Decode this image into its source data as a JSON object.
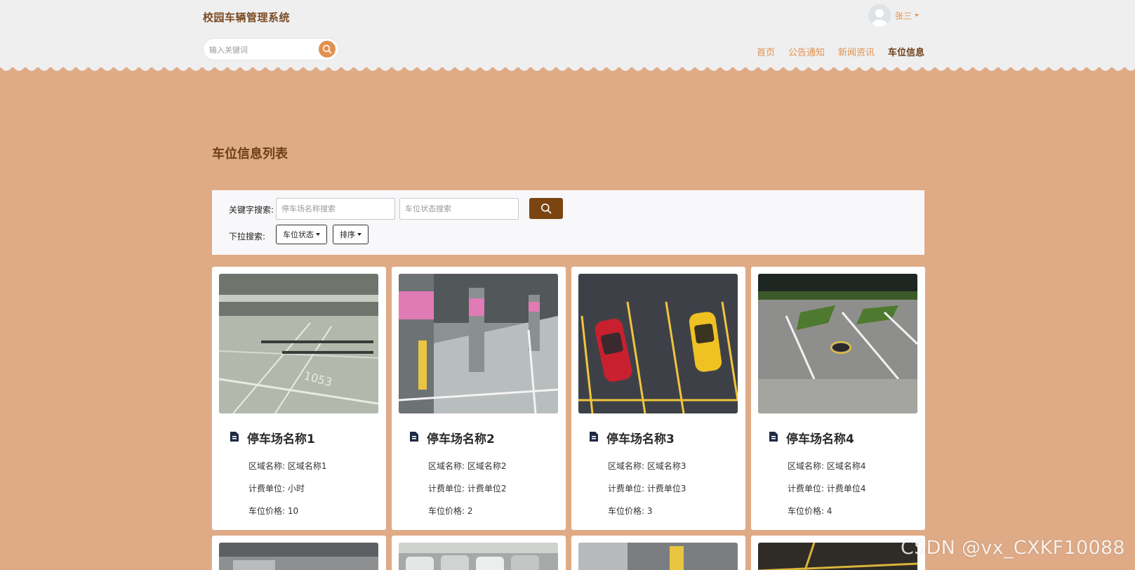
{
  "header": {
    "site_title": "校园车辆管理系统",
    "search_placeholder": "输入关键词",
    "user_name": "张三",
    "nav": [
      {
        "label": "首页",
        "active": false
      },
      {
        "label": "公告通知",
        "active": false
      },
      {
        "label": "新闻资讯",
        "active": false
      },
      {
        "label": "车位信息",
        "active": true
      }
    ]
  },
  "main": {
    "title": "车位信息列表",
    "filter": {
      "keyword_label": "关键字搜索:",
      "parking_placeholder": "停车场名称搜索",
      "status_placeholder": "车位状态搜索",
      "dropdown_label": "下拉搜索:",
      "status_dropdown": "车位状态",
      "sort_dropdown": "排序"
    },
    "cards": [
      {
        "title": "停车场名称1",
        "region": "区域名称: 区域名称1",
        "unit": "计费单位: 小时",
        "price": "车位价格: 10"
      },
      {
        "title": "停车场名称2",
        "region": "区域名称: 区域名称2",
        "unit": "计费单位: 计费单位2",
        "price": "车位价格: 2"
      },
      {
        "title": "停车场名称3",
        "region": "区域名称: 区域名称3",
        "unit": "计费单位: 计费单位3",
        "price": "车位价格: 3"
      },
      {
        "title": "停车场名称4",
        "region": "区域名称: 区域名称4",
        "unit": "计费单位: 计费单位4",
        "price": "车位价格: 4"
      }
    ]
  },
  "watermark": "CSDN @vx_CXKF10088",
  "colors": {
    "background": "#dfab86",
    "header_bg": "#efefef",
    "accent": "#e1914f",
    "brand_dark": "#6d3f17",
    "search_button": "#7b4511"
  }
}
